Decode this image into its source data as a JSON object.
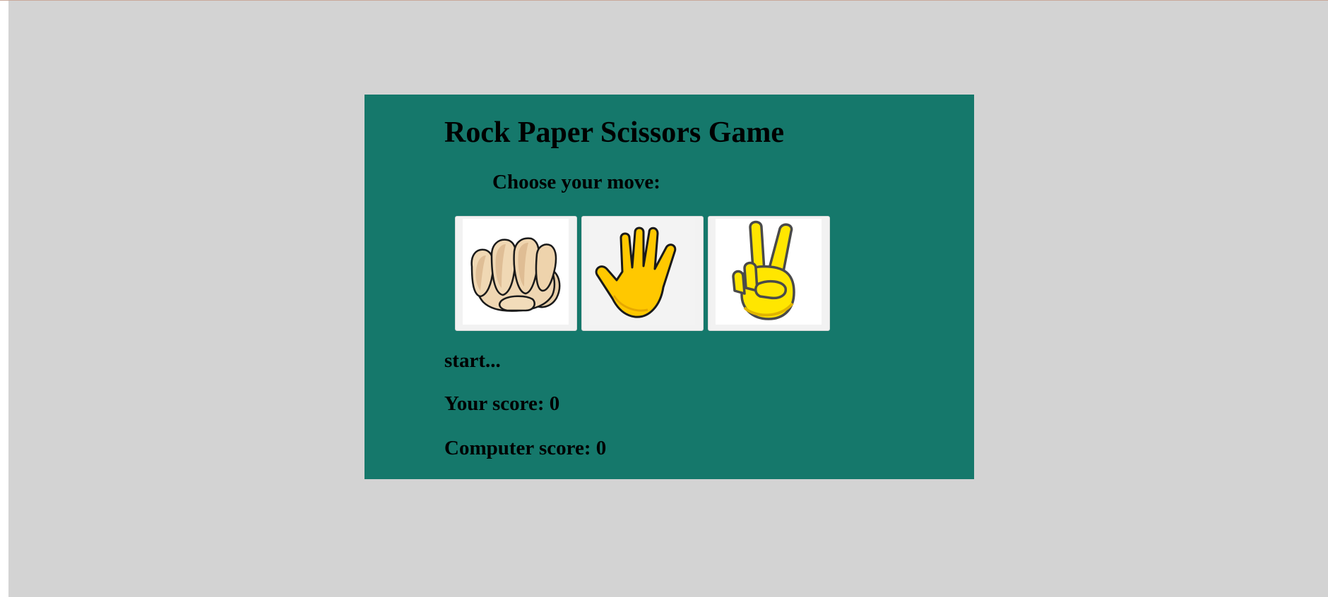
{
  "game": {
    "title": "Rock Paper Scissors Game",
    "subtitle": "Choose your move:",
    "moves": [
      {
        "name": "rock",
        "icon": "fist-icon"
      },
      {
        "name": "paper",
        "icon": "open-hand-icon"
      },
      {
        "name": "scissors",
        "icon": "victory-hand-icon"
      }
    ],
    "status": "start...",
    "user_score_label": "Your score: 0",
    "computer_score_label": "Computer score: 0"
  },
  "colors": {
    "page_background": "#d3d3d3",
    "panel_background": "#15786b",
    "text": "#000000"
  }
}
